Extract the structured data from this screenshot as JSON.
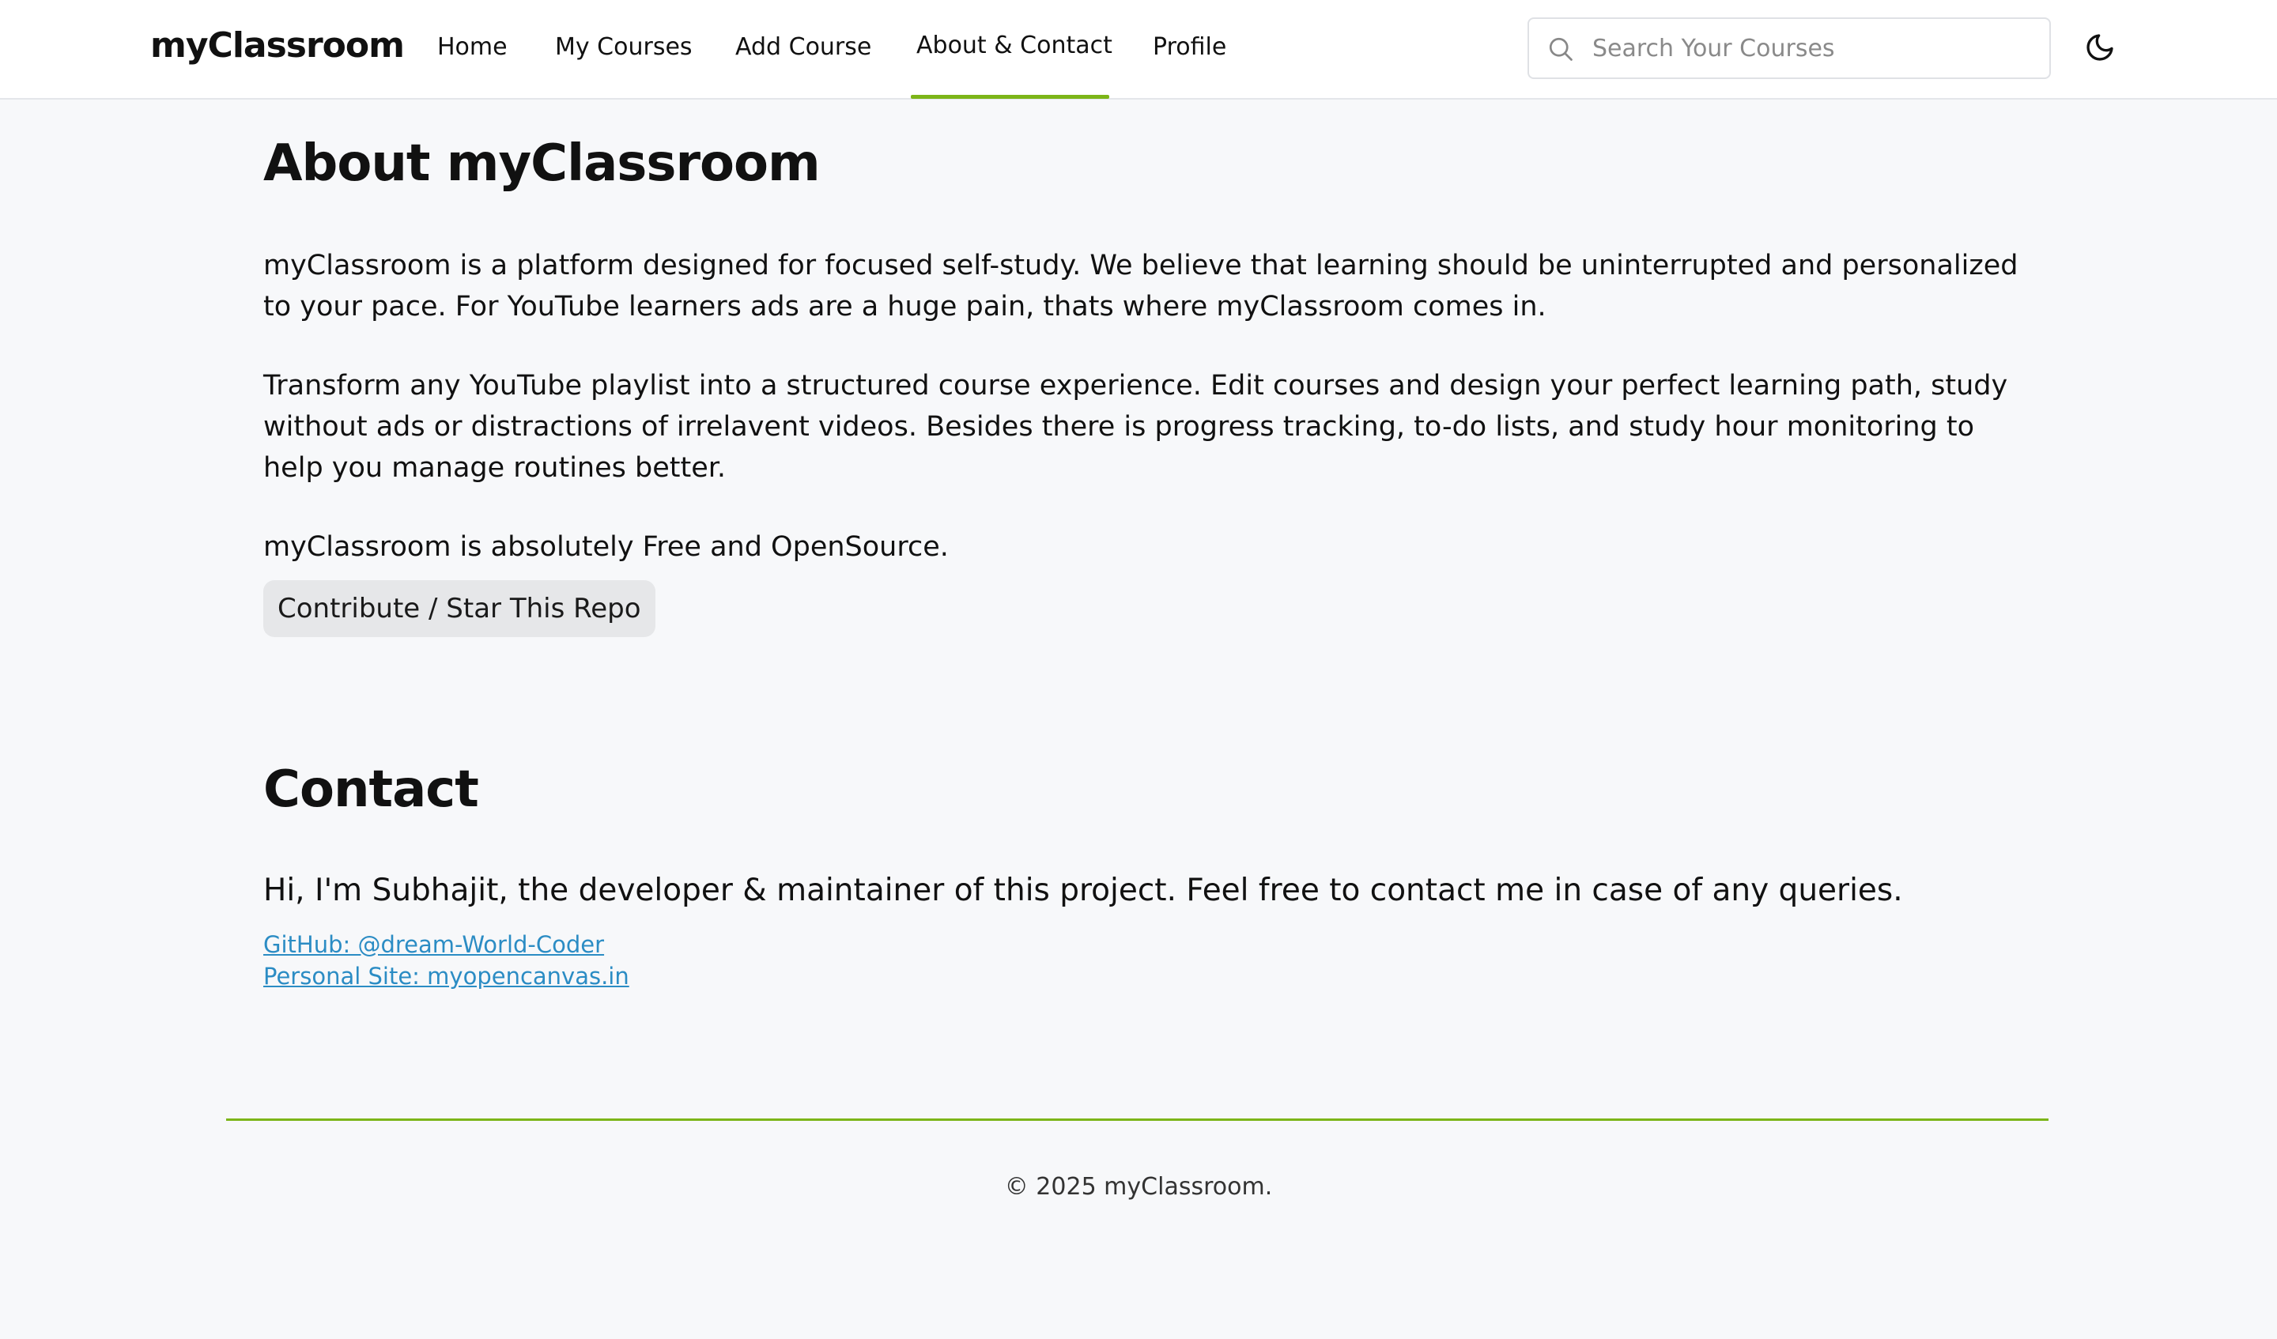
{
  "nav": {
    "brand": "myClassroom",
    "links": [
      {
        "label": "Home"
      },
      {
        "label": "My Courses"
      },
      {
        "label": "Add Course"
      },
      {
        "label": "About & Contact",
        "active": true
      },
      {
        "label": "Profile"
      }
    ],
    "search_placeholder": "Search Your Courses",
    "accent_color": "#7cb518"
  },
  "about": {
    "title": "About myClassroom",
    "paragraphs": [
      "myClassroom is a platform designed for focused self-study. We believe that learning should be uninterrupted and personalized to your pace. For YouTube learners ads are a huge pain, thats where myClassroom comes in.",
      "Transform any YouTube playlist into a structured course experience. Edit courses and design your perfect learning path, study without ads or distractions of irrelavent videos. Besides there is progress tracking, to-do lists, and study hour monitoring to help you manage routines better.",
      "myClassroom is absolutely Free and OpenSource."
    ],
    "repo_button": "Contribute / Star This Repo"
  },
  "contact": {
    "title": "Contact",
    "intro": "Hi, I'm Subhajit, the developer & maintainer of this project. Feel free to contact me in case of any queries.",
    "links": [
      {
        "label": "GitHub: @dream-World-Coder"
      },
      {
        "label": "Personal Site: myopencanvas.in"
      }
    ],
    "link_color": "#2b8cc4"
  },
  "footer": {
    "text": "© 2025 myClassroom."
  },
  "icons": {
    "search": "search-icon",
    "theme": "moon-icon"
  }
}
